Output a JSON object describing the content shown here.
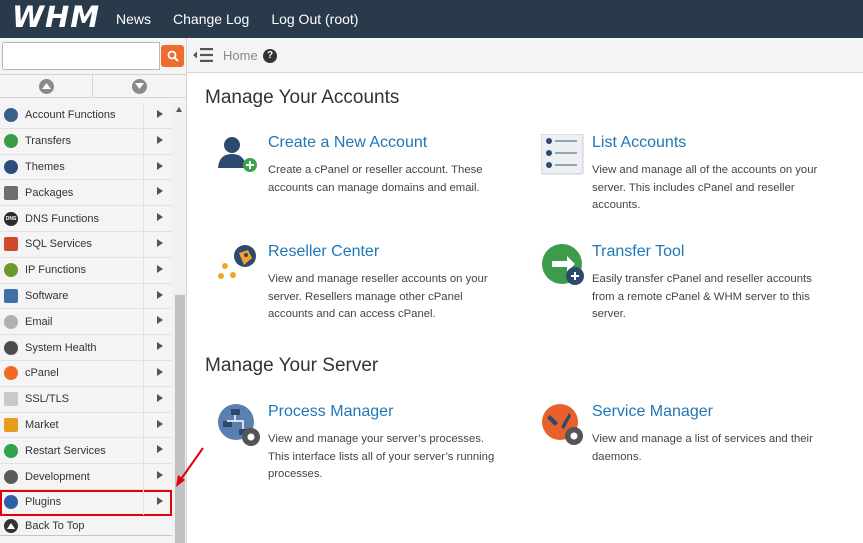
{
  "topbar": {
    "logo": "WHM",
    "links": [
      "News",
      "Change Log",
      "Log Out (root)"
    ]
  },
  "sidebar": {
    "search_placeholder": "",
    "menu": [
      {
        "label": "Account Functions",
        "icon": "account-functions-icon",
        "color": "#3c5f8a"
      },
      {
        "label": "Transfers",
        "icon": "transfers-icon",
        "color": "#3a9b47"
      },
      {
        "label": "Themes",
        "icon": "themes-icon",
        "color": "#2c4c7c"
      },
      {
        "label": "Packages",
        "icon": "packages-icon",
        "color": "#6d6d6d"
      },
      {
        "label": "DNS Functions",
        "icon": "dns-icon",
        "color": "#2b2b2b"
      },
      {
        "label": "SQL Services",
        "icon": "sql-icon",
        "color": "#d04a2a"
      },
      {
        "label": "IP Functions",
        "icon": "ip-functions-icon",
        "color": "#6b9a2c"
      },
      {
        "label": "Software",
        "icon": "software-icon",
        "color": "#3d70a6"
      },
      {
        "label": "Email",
        "icon": "email-icon",
        "color": "#b0b0b0"
      },
      {
        "label": "System Health",
        "icon": "system-health-icon",
        "color": "#4c4c4c"
      },
      {
        "label": "cPanel",
        "icon": "cpanel-icon",
        "color": "#f06a23"
      },
      {
        "label": "SSL/TLS",
        "icon": "ssl-icon",
        "color": "#c9c9c9"
      },
      {
        "label": "Market",
        "icon": "market-icon",
        "color": "#e79f1b"
      },
      {
        "label": "Restart Services",
        "icon": "restart-services-icon",
        "color": "#2ea24c"
      },
      {
        "label": "Development",
        "icon": "development-icon",
        "color": "#5a5a5a"
      },
      {
        "label": "Plugins",
        "icon": "plugins-icon",
        "color": "#2f5ea8"
      }
    ],
    "back_to_top": "Back To Top"
  },
  "breadcrumb": {
    "home": "Home"
  },
  "sections": [
    {
      "title": "Manage Your Accounts",
      "cards": [
        {
          "title": "Create a New Account",
          "desc": "Create a cPanel or reseller account. These accounts can manage domains and email.",
          "icon": "create-account-icon"
        },
        {
          "title": "List Accounts",
          "desc": "View and manage all of the accounts on your server. This includes cPanel and reseller accounts.",
          "icon": "list-accounts-icon"
        },
        {
          "title": "Reseller Center",
          "desc": "View and manage reseller accounts on your server. Resellers manage other cPanel accounts and can access cPanel.",
          "icon": "reseller-center-icon"
        },
        {
          "title": "Transfer Tool",
          "desc": "Easily transfer cPanel and reseller accounts from a remote cPanel & WHM server to this server.",
          "icon": "transfer-tool-icon"
        }
      ]
    },
    {
      "title": "Manage Your Server",
      "cards": [
        {
          "title": "Process Manager",
          "desc": "View and manage your server’s processes. This interface lists all of your server’s running processes.",
          "icon": "process-manager-icon"
        },
        {
          "title": "Service Manager",
          "desc": "View and manage a list of services and their daemons.",
          "icon": "service-manager-icon"
        }
      ]
    }
  ],
  "colors": {
    "topbar": "#293a4a",
    "link": "#1f76b7",
    "search_button": "#ef6c2f",
    "highlight": "#e3000f"
  }
}
